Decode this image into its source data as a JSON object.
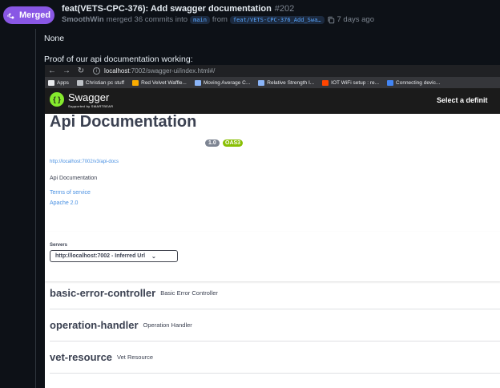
{
  "pr": {
    "state": "Merged",
    "title": "feat(VETS-CPC-376): Add swagger documentation",
    "number": "#202",
    "author": "SmoothWin",
    "merge_text": "merged 36 commits into",
    "base_branch": "main",
    "from_text": "from",
    "head_branch": "feat/VETS-CPC-376_Add_Swa…",
    "time": "7 days ago"
  },
  "comment": {
    "line1": "None",
    "line2": "Proof of our api documentation working:"
  },
  "browser": {
    "url_host": "localhost",
    "url_path": ":7002/swagger-ui/index.html#/",
    "bookmarks": [
      {
        "label": "Apps",
        "icon": "apps-grid-icon",
        "color": "#e8eaed"
      },
      {
        "label": "Christian pc stuff",
        "icon": "folder-icon",
        "color": "#bdc1c6"
      },
      {
        "label": "Red Velvet Waffle...",
        "icon": "recipe-icon",
        "color": "#f9ab00"
      },
      {
        "label": "Moving Average C...",
        "icon": "chart-icon",
        "color": "#8ab4f8"
      },
      {
        "label": "Relative Strength I...",
        "icon": "chart-icon",
        "color": "#8ab4f8"
      },
      {
        "label": "IOT WiFi setup : re...",
        "icon": "reddit-icon",
        "color": "#ff4500"
      },
      {
        "label": "Connecting devic...",
        "icon": "page-icon",
        "color": "#4285f4"
      }
    ]
  },
  "swagger": {
    "brand": "Swagger",
    "brand_sub": "Supported by SMARTBEAR",
    "select_def": "Select a definit",
    "title": "Api Documentation",
    "version": "1.0",
    "oas": "OAS3",
    "api_docs_url": "http://localhost:7002/v3/api-docs",
    "description": "Api Documentation",
    "terms": "Terms of service",
    "license": "Apache 2.0",
    "servers_label": "Servers",
    "server_value": "http://localhost:7002 - Inferred Url",
    "tags": [
      {
        "name": "basic-error-controller",
        "desc": "Basic Error Controller"
      },
      {
        "name": "operation-handler",
        "desc": "Operation Handler"
      },
      {
        "name": "vet-resource",
        "desc": "Vet Resource"
      }
    ]
  },
  "colors": {
    "merged": "#8957e5",
    "link": "#4990e2",
    "swagger_green": "#85ea2d",
    "oas_badge": "#89bf04"
  }
}
